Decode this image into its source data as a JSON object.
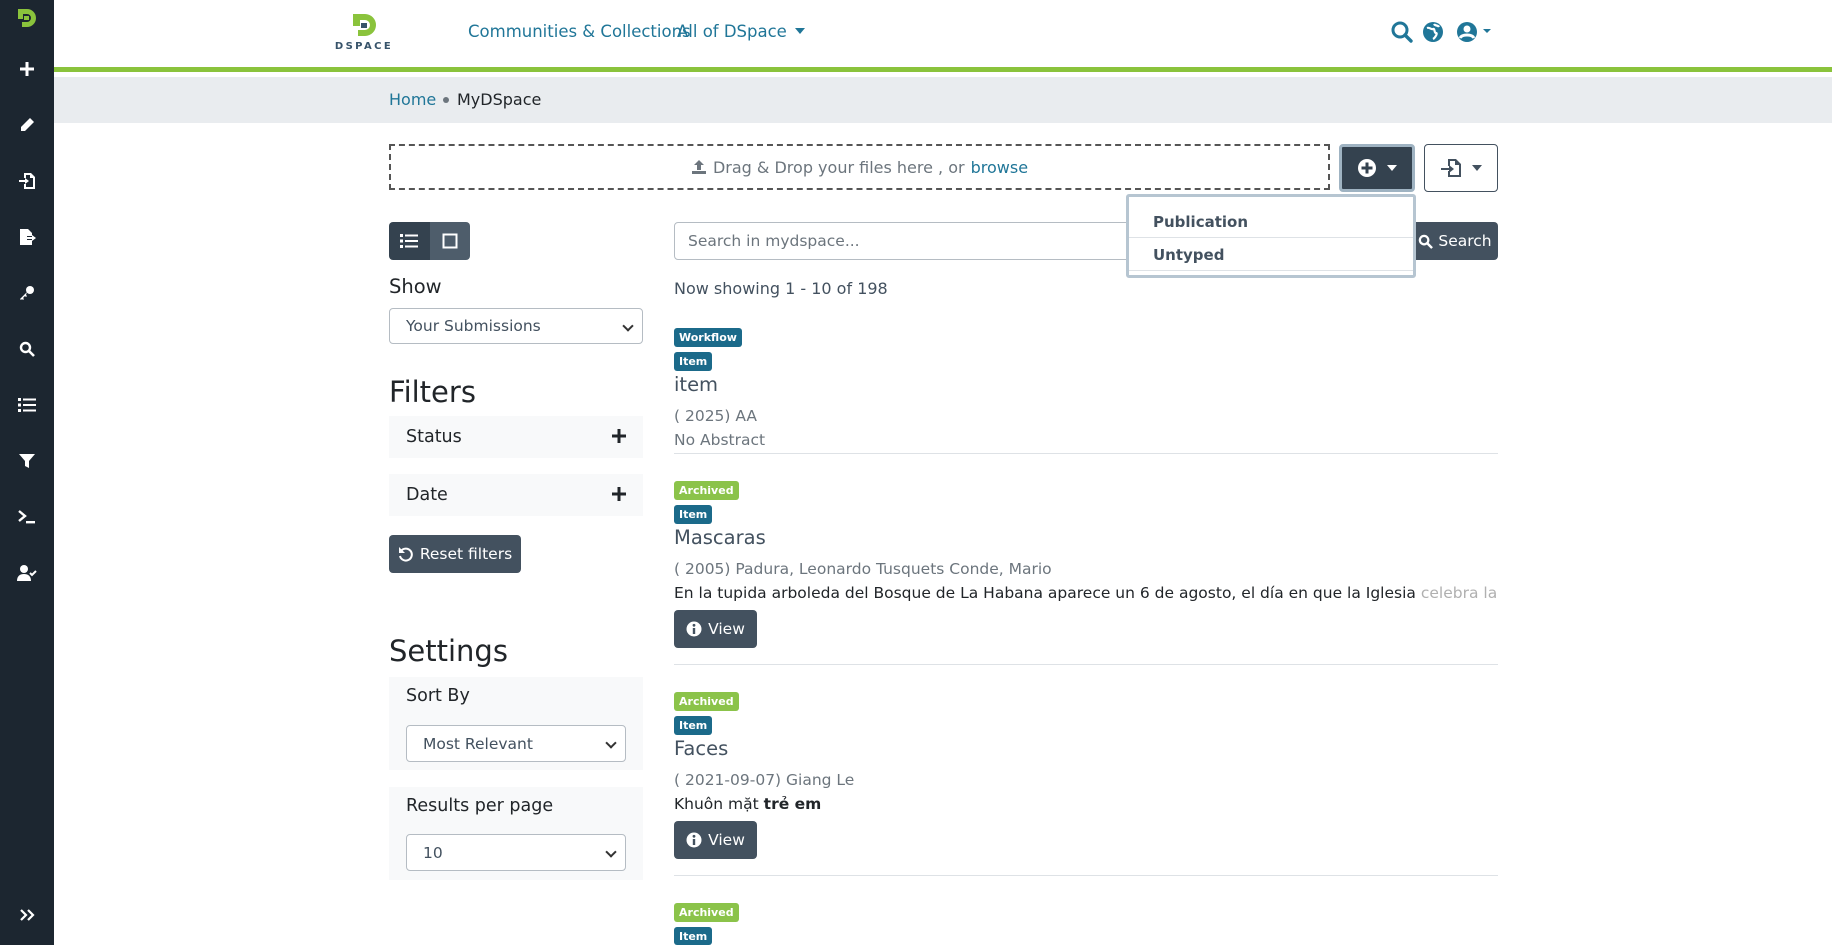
{
  "sidebar": {
    "items": [
      {
        "icon": "plus-icon"
      },
      {
        "icon": "pencil-icon"
      },
      {
        "icon": "import-icon"
      },
      {
        "icon": "export-icon"
      },
      {
        "icon": "key-icon"
      },
      {
        "icon": "search-icon"
      },
      {
        "icon": "list-icon"
      },
      {
        "icon": "filter-icon"
      },
      {
        "icon": "terminal-icon"
      },
      {
        "icon": "user-check-icon"
      }
    ],
    "expand_icon": "double-chevron-right-icon"
  },
  "header": {
    "logo_text": "DSPACE",
    "nav": {
      "communities": "Communities & Collections",
      "all_of": "All of DSpace"
    }
  },
  "breadcrumb": {
    "home": "Home",
    "current": "MyDSpace"
  },
  "upload": {
    "prefix": "Drag & Drop your files here , or",
    "browse": "browse"
  },
  "add_menu": {
    "items": [
      "Publication",
      "Untyped"
    ]
  },
  "sidebar_left": {
    "show_label": "Show",
    "show_value": "Your Submissions",
    "filters_heading": "Filters",
    "filters": [
      "Status",
      "Date"
    ],
    "reset_label": "Reset filters",
    "settings_heading": "Settings",
    "sort_label": "Sort By",
    "sort_value": "Most Relevant",
    "rpp_label": "Results per page",
    "rpp_value": "10"
  },
  "search": {
    "placeholder": "Search in mydspace...",
    "button": "Search",
    "showing": "Now showing 1 - 10 of 198"
  },
  "results": [
    {
      "status": "Workflow",
      "type": "Item",
      "title": "item",
      "meta": "( 2025) AA",
      "abstract": "No Abstract"
    },
    {
      "status": "Archived",
      "type": "Item",
      "title": "Mascaras",
      "meta": "( 2005) Padura, Leonardo Tusquets Conde, Mario",
      "abstract": "En la tupida arboleda del Bosque de La Habana aparece un 6 de agosto, el día en que la Iglesia",
      "abstract_fade": "celebra la",
      "view": "View"
    },
    {
      "status": "Archived",
      "type": "Item",
      "title": "Faces",
      "meta": "( 2021-09-07) Giang Le",
      "abstract_plain": "Khuôn mặt",
      "abstract_bold": "trẻ em",
      "view": "View"
    },
    {
      "status": "Archived",
      "type": "Item"
    }
  ],
  "colors": {
    "sidebar": "#1c2630",
    "accent_green": "#8ac33c",
    "link": "#207698",
    "button_dark": "#43515f"
  }
}
